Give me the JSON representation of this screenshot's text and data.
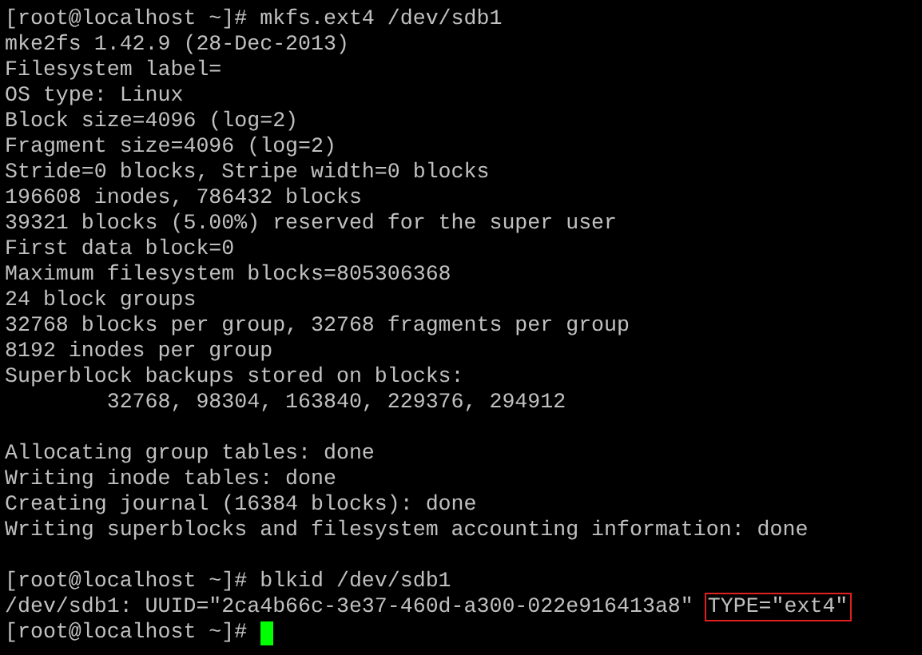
{
  "terminal": {
    "lines": [
      {
        "kind": "text",
        "segments": [
          {
            "text": "[root@localhost ~]# mkfs.ext4 /dev/sdb1",
            "highlighted": false
          }
        ]
      },
      {
        "kind": "text",
        "segments": [
          {
            "text": "mke2fs 1.42.9 (28-Dec-2013)",
            "highlighted": false
          }
        ]
      },
      {
        "kind": "text",
        "segments": [
          {
            "text": "Filesystem label=",
            "highlighted": false
          }
        ]
      },
      {
        "kind": "text",
        "segments": [
          {
            "text": "OS type: Linux",
            "highlighted": false
          }
        ]
      },
      {
        "kind": "text",
        "segments": [
          {
            "text": "Block size=4096 (log=2)",
            "highlighted": false
          }
        ]
      },
      {
        "kind": "text",
        "segments": [
          {
            "text": "Fragment size=4096 (log=2)",
            "highlighted": false
          }
        ]
      },
      {
        "kind": "text",
        "segments": [
          {
            "text": "Stride=0 blocks, Stripe width=0 blocks",
            "highlighted": false
          }
        ]
      },
      {
        "kind": "text",
        "segments": [
          {
            "text": "196608 inodes, 786432 blocks",
            "highlighted": false
          }
        ]
      },
      {
        "kind": "text",
        "segments": [
          {
            "text": "39321 blocks (5.00%) reserved for the super user",
            "highlighted": false
          }
        ]
      },
      {
        "kind": "text",
        "segments": [
          {
            "text": "First data block=0",
            "highlighted": false
          }
        ]
      },
      {
        "kind": "text",
        "segments": [
          {
            "text": "Maximum filesystem blocks=805306368",
            "highlighted": false
          }
        ]
      },
      {
        "kind": "text",
        "segments": [
          {
            "text": "24 block groups",
            "highlighted": false
          }
        ]
      },
      {
        "kind": "text",
        "segments": [
          {
            "text": "32768 blocks per group, 32768 fragments per group",
            "highlighted": false
          }
        ]
      },
      {
        "kind": "text",
        "segments": [
          {
            "text": "8192 inodes per group",
            "highlighted": false
          }
        ]
      },
      {
        "kind": "text",
        "segments": [
          {
            "text": "Superblock backups stored on blocks:",
            "highlighted": false
          }
        ]
      },
      {
        "kind": "text",
        "segments": [
          {
            "text": "        32768, 98304, 163840, 229376, 294912",
            "highlighted": false
          }
        ]
      },
      {
        "kind": "blank"
      },
      {
        "kind": "text",
        "segments": [
          {
            "text": "Allocating group tables: done",
            "highlighted": false
          }
        ]
      },
      {
        "kind": "text",
        "segments": [
          {
            "text": "Writing inode tables: done",
            "highlighted": false
          }
        ]
      },
      {
        "kind": "text",
        "segments": [
          {
            "text": "Creating journal (16384 blocks): done",
            "highlighted": false
          }
        ]
      },
      {
        "kind": "text",
        "segments": [
          {
            "text": "Writing superblocks and filesystem accounting information: done",
            "highlighted": false
          }
        ]
      },
      {
        "kind": "blank"
      },
      {
        "kind": "text",
        "segments": [
          {
            "text": "[root@localhost ~]# blkid /dev/sdb1",
            "highlighted": false
          }
        ]
      },
      {
        "kind": "text",
        "segments": [
          {
            "text": "/dev/sdb1: UUID=\"2ca4b66c-3e37-460d-a300-022e916413a8\"",
            "highlighted": false
          },
          {
            "text": "TYPE=\"ext4\"",
            "highlighted": true
          }
        ]
      },
      {
        "kind": "prompt",
        "segments": [
          {
            "text": "[root@localhost ~]#",
            "highlighted": false
          }
        ],
        "cursor": true
      }
    ]
  }
}
